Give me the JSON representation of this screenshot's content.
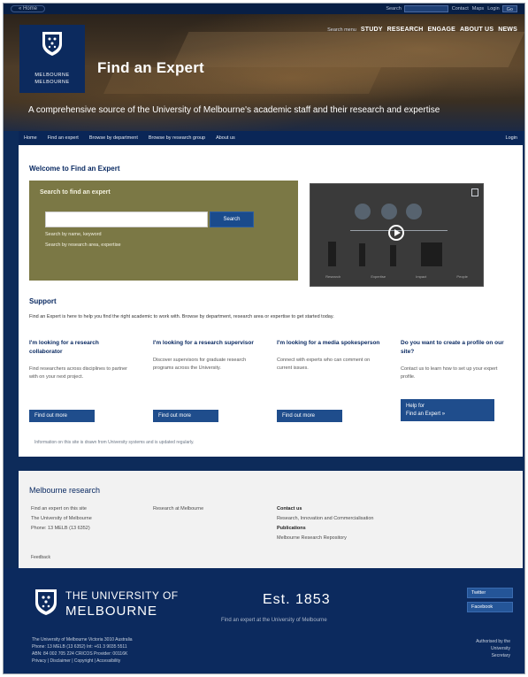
{
  "topbar": {
    "home_link": "« Home",
    "search_label": "Search",
    "links": [
      "Contact",
      "Maps",
      "Login"
    ],
    "go_label": "Go"
  },
  "hero": {
    "nav_lead": "Search menu",
    "nav_items": [
      "STUDY",
      "RESEARCH",
      "ENGAGE",
      "ABOUT US",
      "NEWS"
    ],
    "logo_line1": "MELBOURNE",
    "logo_line2": "MELBOURNE",
    "site_title": "Find an Expert",
    "tagline": "A comprehensive source of the University of Melbourne's academic staff and their research and expertise"
  },
  "mainnav": {
    "items": [
      "Home",
      "Find an expert",
      "Browse by department",
      "Browse by research group",
      "About us"
    ],
    "login": "Login"
  },
  "welcome": {
    "heading": "Welcome to Find an Expert"
  },
  "search_panel": {
    "title": "Search to find an expert",
    "placeholder": "",
    "button": "Search",
    "option1": "Search by name, keyword",
    "option2": "Search by research area, expertise"
  },
  "video": {
    "captions": [
      "Research",
      "Expertise",
      "Impact",
      "People"
    ]
  },
  "support": {
    "title": "Support",
    "text": "Find an Expert is here to help you find the right academic to work with. Browse by department, research area or expertise to get started today."
  },
  "cards": [
    {
      "title": "I'm looking for a research collaborator",
      "body": "Find researchers across disciplines to partner with on your next project.",
      "button": "Find out more"
    },
    {
      "title": "I'm looking for a research supervisor",
      "body": "Discover supervisors for graduate research programs across the University.",
      "button": "Find out more"
    },
    {
      "title": "I'm looking for a media spokesperson",
      "body": "Connect with experts who can comment on current issues.",
      "button": "Find out more"
    },
    {
      "title": "Do you want to create a profile on our site?",
      "body": "Contact us to learn how to set up your expert profile.",
      "button_line1": "Help for",
      "button_line2": "Find an Expert »"
    }
  ],
  "content_footnote": "Information on this site is drawn from University systems and is updated regularly.",
  "research": {
    "title": "Melbourne research",
    "col1": [
      "Find an expert on this site",
      "The University of Melbourne",
      "Phone: 13 MELB (13 6352)"
    ],
    "col2": [
      "Research at Melbourne"
    ],
    "col3_bold1": "Contact us",
    "col3": [
      "Research, Innovation and Commercialisation"
    ],
    "col3_bold2": "Publications",
    "col3b": [
      "Melbourne Research Repository"
    ],
    "small": "Feedback"
  },
  "footer": {
    "uni1": "THE UNIVERSITY OF",
    "uni2": "MELBOURNE",
    "est": "Est. 1853",
    "est_sub": "Find an expert at the University of Melbourne",
    "social": [
      "Twitter",
      "Facebook"
    ],
    "address": [
      "The University of Melbourne Victoria 3010 Australia",
      "Phone: 13 MELB (13 6352) Int: +61 3 9035 5511",
      "ABN: 84 002 705 224 CRICOS Provider: 00116K",
      "Privacy | Disclaimer | Copyright | Accessibility"
    ],
    "right": [
      "Authorised by the",
      "University",
      "Secretary"
    ]
  },
  "colors": {
    "navy": "#0c2a5e",
    "olive": "#7b7845",
    "button_blue": "#1f4d8c"
  }
}
